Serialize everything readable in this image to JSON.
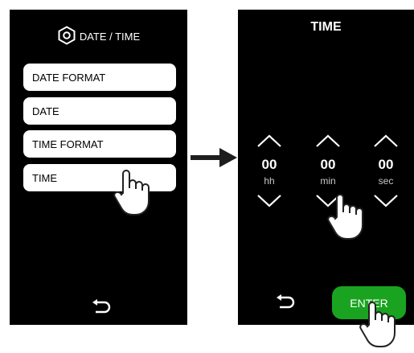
{
  "left_screen": {
    "title": "DATE / TIME",
    "menu_items": [
      {
        "label": "DATE FORMAT"
      },
      {
        "label": "DATE"
      },
      {
        "label": "TIME FORMAT"
      },
      {
        "label": "TIME"
      }
    ]
  },
  "right_screen": {
    "title": "TIME",
    "fields": [
      {
        "value": "00",
        "unit": "hh"
      },
      {
        "value": "00",
        "unit": "min"
      },
      {
        "value": "00",
        "unit": "sec"
      }
    ],
    "enter_label": "ENTER"
  },
  "colors": {
    "screen_bg": "#000000",
    "button_bg": "#ffffff",
    "enter_bg": "#1aa320"
  },
  "icons": [
    "settings-hexagon-icon",
    "back-arrow-icon",
    "chevron-up-icon",
    "chevron-down-icon",
    "arrow-right-icon",
    "hand-pointer-icon"
  ]
}
